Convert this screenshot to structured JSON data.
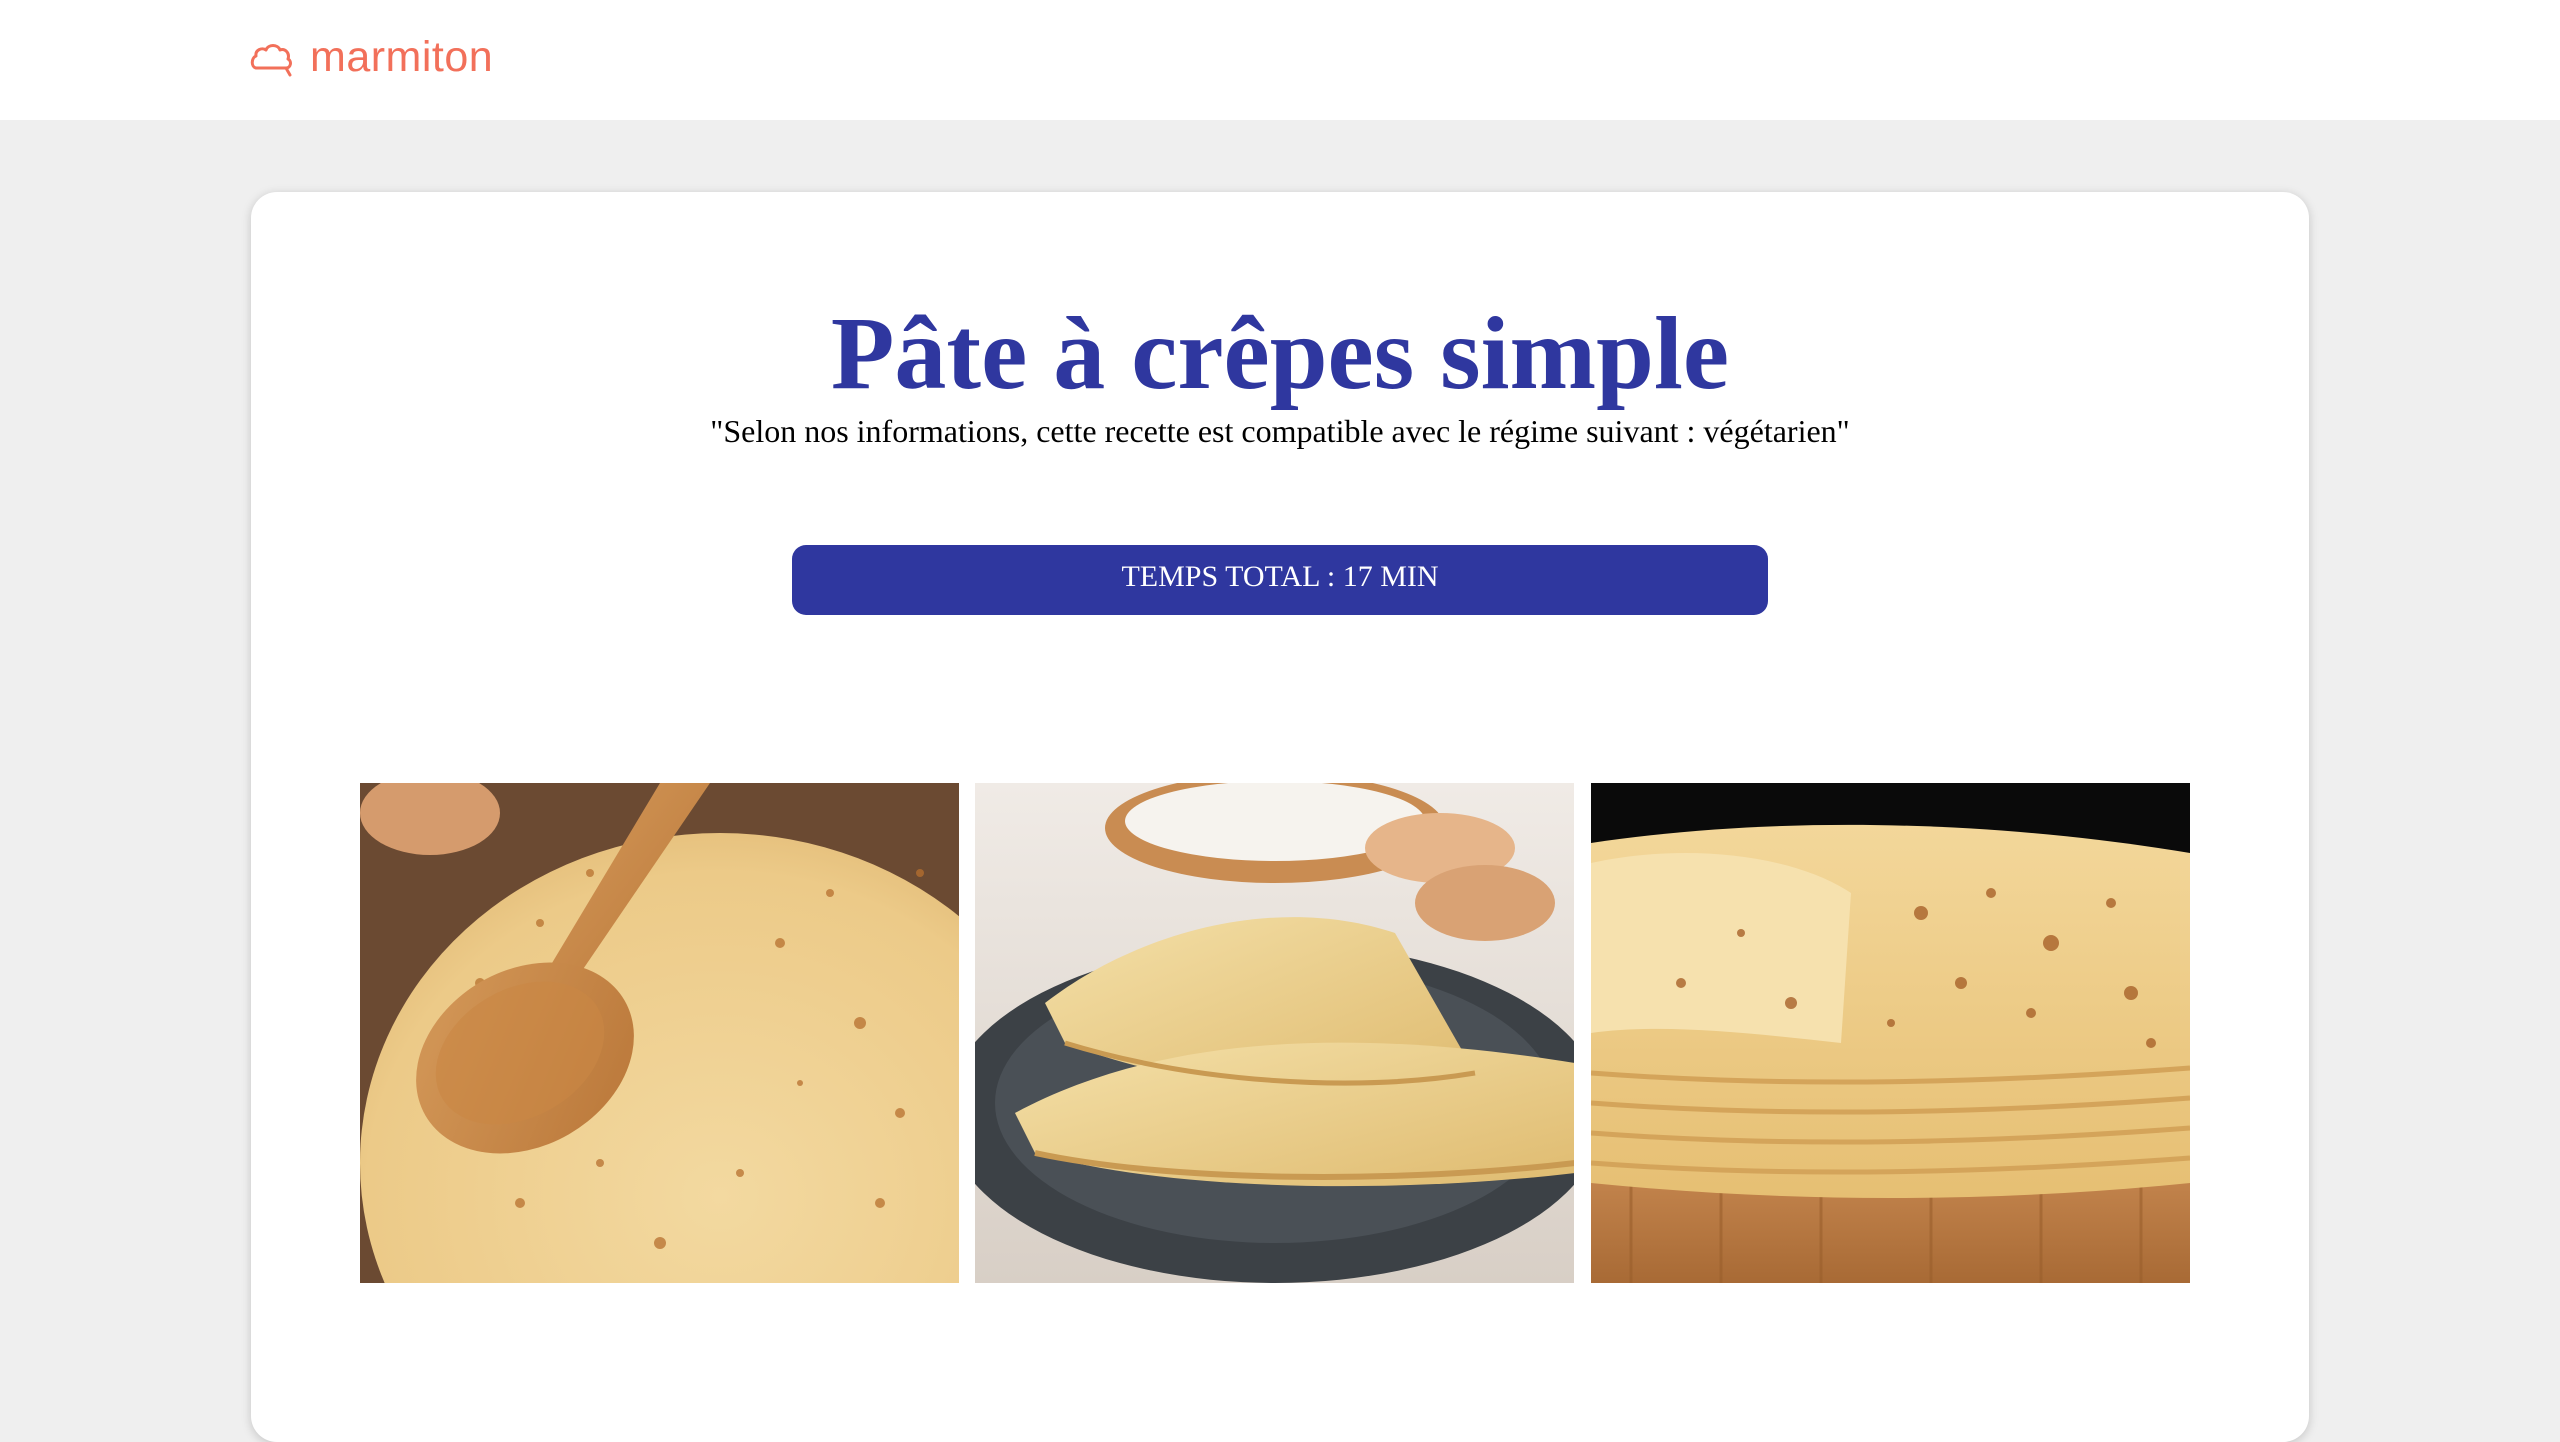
{
  "header": {
    "logo_text": "marmiton",
    "logo_icon": "chef-hat-icon",
    "brand_color": "#f2705a"
  },
  "recipe": {
    "title": "Pâte à crêpes simple",
    "diet_note": "\"Selon nos informations, cette recette est compatible avec le régime suivant : végétarien\"",
    "total_time": "TEMPS TOTAL : 17 MIN",
    "accent_color": "#2f379f"
  },
  "gallery": {
    "photos": [
      {
        "name": "crepes-with-wooden-spoon-photo"
      },
      {
        "name": "folded-crepes-on-plate-photo"
      },
      {
        "name": "stack-of-crepes-on-board-photo"
      }
    ]
  }
}
